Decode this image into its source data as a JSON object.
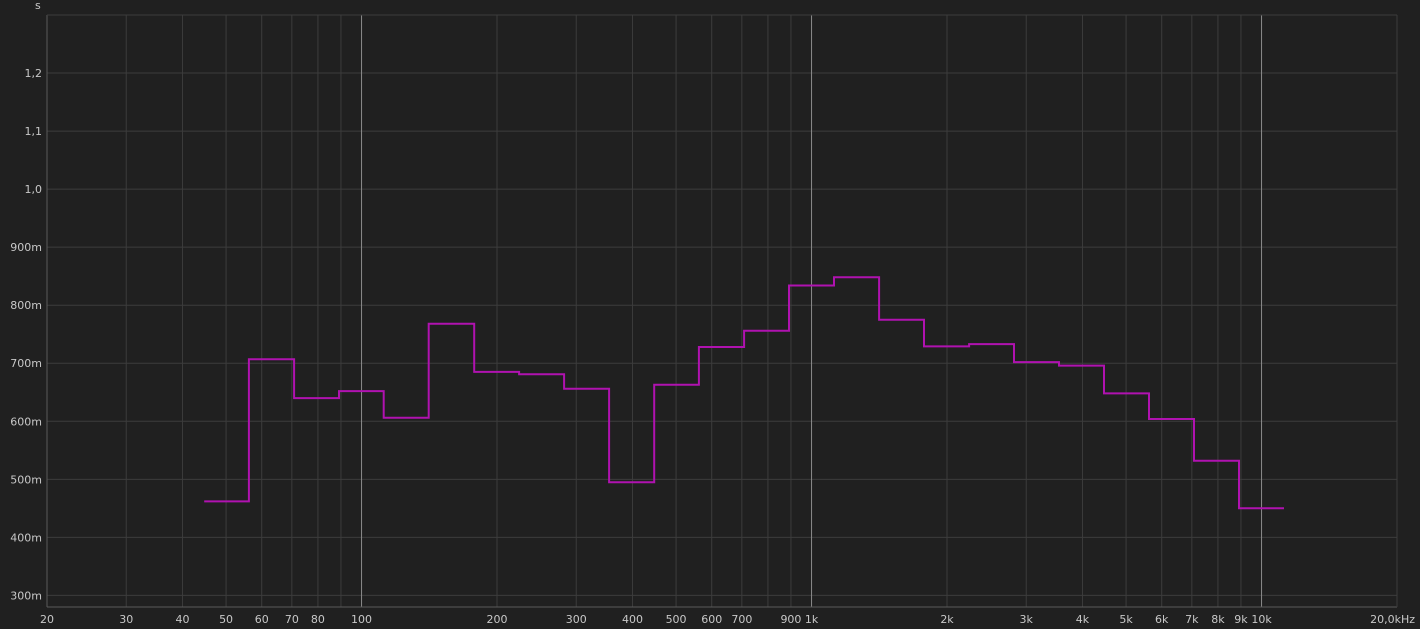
{
  "chart_data": {
    "type": "line",
    "title": "",
    "xlabel": "",
    "ylabel": "s",
    "x_scale": "log",
    "xlim": [
      20,
      20000
    ],
    "ylim": [
      280,
      1300
    ],
    "grid": true,
    "background": "#202020",
    "grid_color": "#3c3c3c",
    "major_grid_color": "#8a8a8a",
    "series_color": "#b012b0",
    "y_ticks": [
      {
        "value": 300,
        "label": "300m"
      },
      {
        "value": 400,
        "label": "400m"
      },
      {
        "value": 500,
        "label": "500m"
      },
      {
        "value": 600,
        "label": "600m"
      },
      {
        "value": 700,
        "label": "700m"
      },
      {
        "value": 800,
        "label": "800m"
      },
      {
        "value": 900,
        "label": "900m"
      },
      {
        "value": 1000,
        "label": "1,0"
      },
      {
        "value": 1100,
        "label": "1,1"
      },
      {
        "value": 1200,
        "label": "1,2"
      }
    ],
    "x_ticks": [
      {
        "value": 20,
        "label": "20"
      },
      {
        "value": 30,
        "label": "30"
      },
      {
        "value": 40,
        "label": "40"
      },
      {
        "value": 50,
        "label": "50"
      },
      {
        "value": 60,
        "label": "60"
      },
      {
        "value": 70,
        "label": "70"
      },
      {
        "value": 80,
        "label": "80"
      },
      {
        "value": 100,
        "label": "100"
      },
      {
        "value": 200,
        "label": "200"
      },
      {
        "value": 300,
        "label": "300"
      },
      {
        "value": 400,
        "label": "400"
      },
      {
        "value": 500,
        "label": "500"
      },
      {
        "value": 600,
        "label": "600"
      },
      {
        "value": 700,
        "label": "700"
      },
      {
        "value": 900,
        "label": "900"
      },
      {
        "value": 1000,
        "label": "1k"
      },
      {
        "value": 2000,
        "label": "2k"
      },
      {
        "value": 3000,
        "label": "3k"
      },
      {
        "value": 4000,
        "label": "4k"
      },
      {
        "value": 5000,
        "label": "5k"
      },
      {
        "value": 6000,
        "label": "6k"
      },
      {
        "value": 7000,
        "label": "7k"
      },
      {
        "value": 8000,
        "label": "8k"
      },
      {
        "value": 9000,
        "label": "9k"
      },
      {
        "value": 10000,
        "label": "10k"
      },
      {
        "value": 20000,
        "label": "20,0kHz"
      }
    ],
    "x_grid": [
      20,
      30,
      40,
      50,
      60,
      70,
      80,
      90,
      100,
      200,
      300,
      400,
      500,
      600,
      700,
      800,
      900,
      1000,
      2000,
      3000,
      4000,
      5000,
      6000,
      7000,
      8000,
      9000,
      10000,
      20000
    ],
    "x_major_grid": [
      100,
      1000,
      10000
    ],
    "series": [
      {
        "bands": [
          {
            "from": 44.7,
            "to": 56.2,
            "value": 462
          },
          {
            "from": 56.2,
            "to": 70.8,
            "value": 707
          },
          {
            "from": 70.8,
            "to": 89.1,
            "value": 640
          },
          {
            "from": 89.1,
            "to": 112,
            "value": 652
          },
          {
            "from": 112,
            "to": 141,
            "value": 606
          },
          {
            "from": 141,
            "to": 178,
            "value": 768
          },
          {
            "from": 178,
            "to": 224,
            "value": 685
          },
          {
            "from": 224,
            "to": 282,
            "value": 681
          },
          {
            "from": 282,
            "to": 355,
            "value": 656
          },
          {
            "from": 355,
            "to": 447,
            "value": 495
          },
          {
            "from": 447,
            "to": 562,
            "value": 663
          },
          {
            "from": 562,
            "to": 708,
            "value": 728
          },
          {
            "from": 708,
            "to": 891,
            "value": 756
          },
          {
            "from": 891,
            "to": 1122,
            "value": 834
          },
          {
            "from": 1122,
            "to": 1413,
            "value": 848
          },
          {
            "from": 1413,
            "to": 1778,
            "value": 775
          },
          {
            "from": 1778,
            "to": 2239,
            "value": 729
          },
          {
            "from": 2239,
            "to": 2818,
            "value": 733
          },
          {
            "from": 2818,
            "to": 3548,
            "value": 702
          },
          {
            "from": 3548,
            "to": 4467,
            "value": 696
          },
          {
            "from": 4467,
            "to": 5623,
            "value": 648
          },
          {
            "from": 5623,
            "to": 7079,
            "value": 604
          },
          {
            "from": 7079,
            "to": 8913,
            "value": 532
          },
          {
            "from": 8913,
            "to": 11220,
            "value": 450
          }
        ]
      }
    ]
  }
}
